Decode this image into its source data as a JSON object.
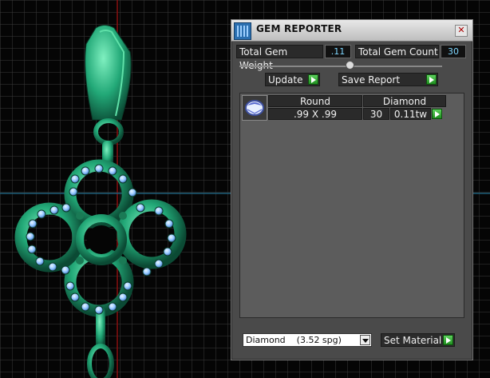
{
  "window": {
    "title": "GEM REPORTER",
    "close_glyph": "✕"
  },
  "summary": {
    "weight_label": "Total Gem Weight",
    "weight_value": ".11",
    "count_label": "Total Gem Count",
    "count_value": "30"
  },
  "actions": {
    "update_label": "Update",
    "save_label": "Save Report"
  },
  "gem_table": {
    "headers": [
      "Round",
      "Diamond"
    ],
    "rows": [
      {
        "size": ".99 X .99",
        "count": "30",
        "weight": "0.11tw"
      }
    ]
  },
  "material": {
    "selected": "Diamond    (3.52 spg)",
    "set_label": "Set Material"
  },
  "colors": {
    "accent_go": "#2faa2f",
    "value_text": "#7fd7ff",
    "model_green": "#2fb585",
    "gem_blue": "#8fc4ff"
  },
  "icons": [
    "gem-reporter-logo-icon",
    "close-icon",
    "go-arrow-icon",
    "dropdown-arrow-icon",
    "round-gem-icon"
  ]
}
